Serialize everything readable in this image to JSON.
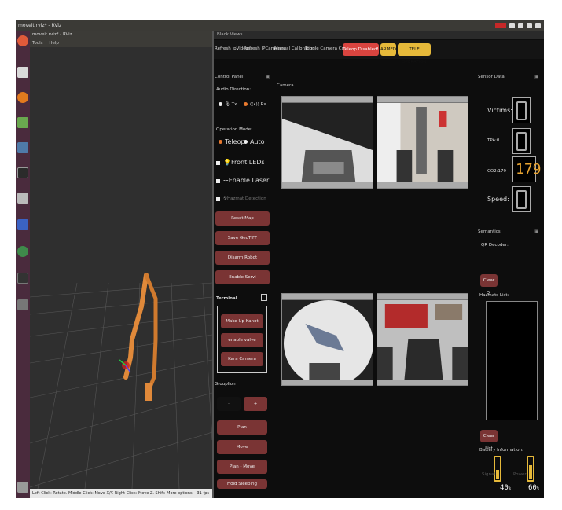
{
  "topbar": {
    "title": "moveit.rviz* - RViz"
  },
  "rviz": {
    "window_title": "moveit.rviz* - RViz",
    "menu": [
      "Tools",
      "Help"
    ],
    "status_text": "Left-Click: Rotate. Middle-Click: Move X/Y. Right-Click: Move Z. Shift: More options.",
    "fps": "31 fps"
  },
  "blackviews": {
    "window_title": "Black Views",
    "toolbar": {
      "refresh_ipvideos": "Refresh IpVideos",
      "refresh_ipcameras": "Refresh IPCameras",
      "manual_calibration": "Manual Calibration",
      "toggle_camera_controls": "Toggle Camera Controls",
      "teleop_status": "Teleop Disabled!",
      "armed": "ARMED",
      "tele_operation": "TELE OPERATION"
    },
    "control_panel": {
      "title": "Control Panel",
      "audio_direction": "Audio Direction:",
      "tx": "Tx",
      "rx": "Rx",
      "operation_mode": "Operation Mode:",
      "teleop": "Teleop",
      "auto": "Auto",
      "front_leds": "Front LEDs",
      "enable_laser": "Enable Laser",
      "hazmat_detection": "Hazmat Detection",
      "buttons": [
        "Reset Map",
        "Save GeoTIFF",
        "Disarm Robot",
        "Enable Servi"
      ]
    },
    "terminal": {
      "title": "Terminal",
      "buttons": [
        "Make Up Kanot",
        "enable valve",
        "Kara Camera"
      ]
    },
    "gripper": {
      "title": "Grouplion",
      "minus": "-",
      "plus": "+",
      "buttons": [
        "Plan",
        "Move",
        "Plan - Move",
        "Hold Sleeping"
      ]
    },
    "cameras_title": "Camera",
    "sensor_data": {
      "title": "Sensor Data",
      "victims": "Victims:",
      "tpa": "TPA:0",
      "co2": "CO2:179",
      "co2_value": "179",
      "speed": "Speed:"
    },
    "semantics": {
      "title": "Semantics",
      "qr_decoder": "QR Decoder:",
      "qr_value": "—",
      "clear_qr": "Clear Qr",
      "hazmats_list": "Hazmats List:",
      "clear_list": "Clear List",
      "battery_info": "Battery Information:",
      "signal": "Signal",
      "power": "Power",
      "signal_value": "40",
      "power_value": "60",
      "percent": "%"
    }
  },
  "colors": {
    "teleop_red": "#d9443f",
    "armed_yellow": "#e6b93a",
    "button_red": "#7a3434",
    "robot_arm": "#e0893a",
    "launcher": "#4a2b3d"
  }
}
